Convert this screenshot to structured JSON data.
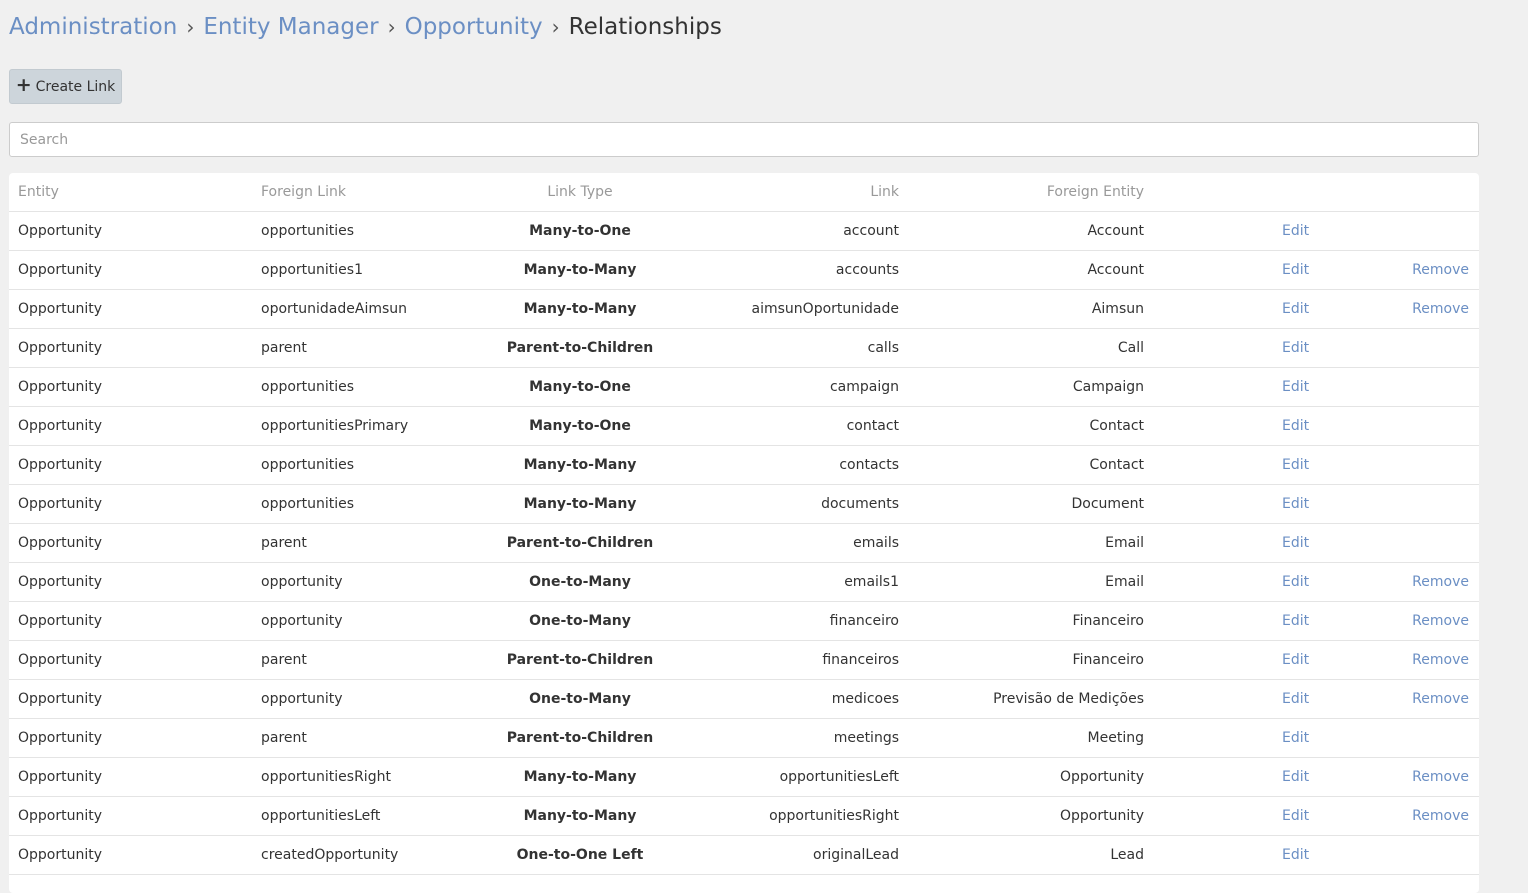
{
  "breadcrumb": {
    "items": [
      "Administration",
      "Entity Manager",
      "Opportunity"
    ],
    "separator": "›",
    "current": "Relationships"
  },
  "toolbar": {
    "create_icon": "plus-icon",
    "create_label": "Create Link"
  },
  "search": {
    "placeholder": "Search",
    "value": ""
  },
  "table": {
    "headers": {
      "entity": "Entity",
      "foreign_link": "Foreign Link",
      "link_type": "Link Type",
      "link": "Link",
      "foreign_entity": "Foreign Entity"
    },
    "edit_label": "Edit",
    "remove_label": "Remove",
    "rows": [
      {
        "entity": "Opportunity",
        "foreign_link": "opportunities",
        "link_type": "Many-to-One",
        "link": "account",
        "foreign_entity": "Account",
        "removable": false
      },
      {
        "entity": "Opportunity",
        "foreign_link": "opportunities1",
        "link_type": "Many-to-Many",
        "link": "accounts",
        "foreign_entity": "Account",
        "removable": true
      },
      {
        "entity": "Opportunity",
        "foreign_link": "oportunidadeAimsun",
        "link_type": "Many-to-Many",
        "link": "aimsunOportunidade",
        "foreign_entity": "Aimsun",
        "removable": true
      },
      {
        "entity": "Opportunity",
        "foreign_link": "parent",
        "link_type": "Parent-to-Children",
        "link": "calls",
        "foreign_entity": "Call",
        "removable": false
      },
      {
        "entity": "Opportunity",
        "foreign_link": "opportunities",
        "link_type": "Many-to-One",
        "link": "campaign",
        "foreign_entity": "Campaign",
        "removable": false
      },
      {
        "entity": "Opportunity",
        "foreign_link": "opportunitiesPrimary",
        "link_type": "Many-to-One",
        "link": "contact",
        "foreign_entity": "Contact",
        "removable": false
      },
      {
        "entity": "Opportunity",
        "foreign_link": "opportunities",
        "link_type": "Many-to-Many",
        "link": "contacts",
        "foreign_entity": "Contact",
        "removable": false
      },
      {
        "entity": "Opportunity",
        "foreign_link": "opportunities",
        "link_type": "Many-to-Many",
        "link": "documents",
        "foreign_entity": "Document",
        "removable": false
      },
      {
        "entity": "Opportunity",
        "foreign_link": "parent",
        "link_type": "Parent-to-Children",
        "link": "emails",
        "foreign_entity": "Email",
        "removable": false
      },
      {
        "entity": "Opportunity",
        "foreign_link": "opportunity",
        "link_type": "One-to-Many",
        "link": "emails1",
        "foreign_entity": "Email",
        "removable": true
      },
      {
        "entity": "Opportunity",
        "foreign_link": "opportunity",
        "link_type": "One-to-Many",
        "link": "financeiro",
        "foreign_entity": "Financeiro",
        "removable": true
      },
      {
        "entity": "Opportunity",
        "foreign_link": "parent",
        "link_type": "Parent-to-Children",
        "link": "financeiros",
        "foreign_entity": "Financeiro",
        "removable": true
      },
      {
        "entity": "Opportunity",
        "foreign_link": "opportunity",
        "link_type": "One-to-Many",
        "link": "medicoes",
        "foreign_entity": "Previsão de Medições",
        "removable": true
      },
      {
        "entity": "Opportunity",
        "foreign_link": "parent",
        "link_type": "Parent-to-Children",
        "link": "meetings",
        "foreign_entity": "Meeting",
        "removable": false
      },
      {
        "entity": "Opportunity",
        "foreign_link": "opportunitiesRight",
        "link_type": "Many-to-Many",
        "link": "opportunitiesLeft",
        "foreign_entity": "Opportunity",
        "removable": true
      },
      {
        "entity": "Opportunity",
        "foreign_link": "opportunitiesLeft",
        "link_type": "Many-to-Many",
        "link": "opportunitiesRight",
        "foreign_entity": "Opportunity",
        "removable": true
      },
      {
        "entity": "Opportunity",
        "foreign_link": "createdOpportunity",
        "link_type": "One-to-One Left",
        "link": "originalLead",
        "foreign_entity": "Lead",
        "removable": false
      }
    ]
  }
}
